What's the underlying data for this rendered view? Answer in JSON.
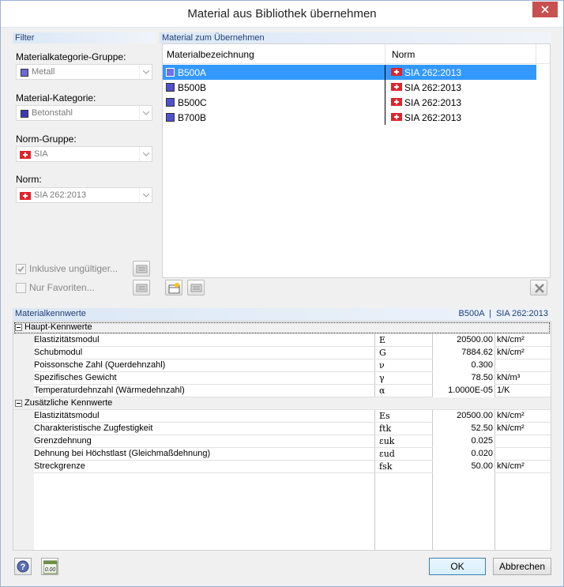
{
  "window": {
    "title": "Material aus Bibliothek übernehmen",
    "close_glyph": "✕"
  },
  "filter": {
    "header": "Filter",
    "category_group_label": "Materialkategorie-Gruppe:",
    "category_group_value": "Metall",
    "category_label": "Material-Kategorie:",
    "category_value": "Betonstahl",
    "norm_group_label": "Norm-Gruppe:",
    "norm_group_value": "SIA",
    "norm_label": "Norm:",
    "norm_value": "SIA 262:2013",
    "include_invalid_label": "Inklusive ungültiger...",
    "include_invalid_checked": true,
    "favorites_label": "Nur Favoriten...",
    "favorites_checked": false
  },
  "materials": {
    "header": "Material zum Übernehmen",
    "col_name": "Materialbezeichnung",
    "col_norm": "Norm",
    "rows": [
      {
        "name": "B500A",
        "norm": "SIA 262:2013",
        "selected": true
      },
      {
        "name": "B500B",
        "norm": "SIA 262:2013",
        "selected": false
      },
      {
        "name": "B500C",
        "norm": "SIA 262:2013",
        "selected": false
      },
      {
        "name": "B700B",
        "norm": "SIA 262:2013",
        "selected": false
      }
    ]
  },
  "properties": {
    "header": "Materialkennwerte",
    "selection_material": "B500A",
    "selection_separator": "|",
    "selection_norm": "SIA 262:2013",
    "groups": [
      {
        "label": "Haupt-Kennwerte",
        "rows": [
          {
            "name": "Elastizitätsmodul",
            "symbol": "E",
            "value": "20500.00",
            "unit": "kN/cm²"
          },
          {
            "name": "Schubmodul",
            "symbol": "G",
            "value": "7884.62",
            "unit": "kN/cm²"
          },
          {
            "name": "Poissonsche Zahl (Querdehnzahl)",
            "symbol": "ν",
            "value": "0.300",
            "unit": ""
          },
          {
            "name": "Spezifisches Gewicht",
            "symbol": "γ",
            "value": "78.50",
            "unit": "kN/m³"
          },
          {
            "name": "Temperaturdehnzahl (Wärmedehnzahl)",
            "symbol": "α",
            "value": "1.0000E-05",
            "unit": "1/K"
          }
        ]
      },
      {
        "label": "Zusätzliche Kennwerte",
        "rows": [
          {
            "name": "Elastizitätsmodul",
            "symbol": "Es",
            "value": "20500.00",
            "unit": "kN/cm²"
          },
          {
            "name": "Charakteristische Zugfestigkeit",
            "symbol": "ftk",
            "value": "52.50",
            "unit": "kN/cm²"
          },
          {
            "name": "Grenzdehnung",
            "symbol": "εuk",
            "value": "0.025",
            "unit": ""
          },
          {
            "name": "Dehnung bei Höchstlast (Gleichmaßdehnung)",
            "symbol": "εud",
            "value": "0.020",
            "unit": ""
          },
          {
            "name": "Streckgrenze",
            "symbol": "fsk",
            "value": "50.00",
            "unit": "kN/cm²"
          }
        ]
      }
    ]
  },
  "footer": {
    "ok_label": "OK",
    "cancel_label": "Abbrechen",
    "units_icon_text": "0.00"
  },
  "colors": {
    "selection": "#3399ff",
    "material_swatch": "#5050d0",
    "header_text": "#1e3f75",
    "swiss_red": "#e0242c"
  }
}
